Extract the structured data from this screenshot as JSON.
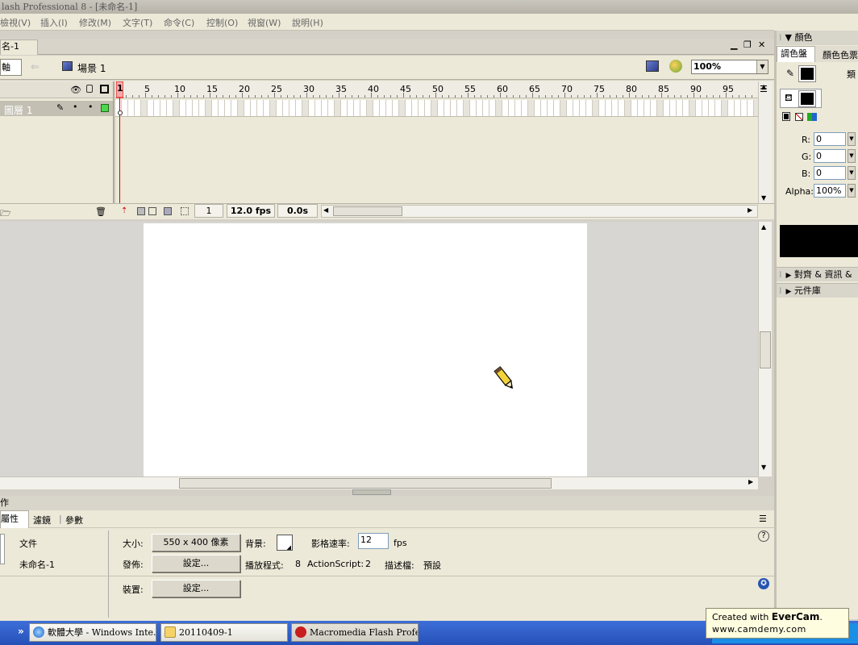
{
  "window": {
    "title": "lash Professional 8 - [未命名-1]"
  },
  "menubar": {
    "items": [
      "檢視(V)",
      "插入(I)",
      "修改(M)",
      "文字(T)",
      "命令(C)",
      "控制(O)",
      "視窗(W)",
      "說明(H)"
    ]
  },
  "document": {
    "tab_label": "名-1",
    "timeline_toggle": "軸",
    "scene_label": "場景 1",
    "zoom": "100%"
  },
  "timeline": {
    "ruler_numbers": [
      "1",
      "5",
      "10",
      "15",
      "20",
      "25",
      "30",
      "35",
      "40",
      "45",
      "50",
      "55",
      "60",
      "65",
      "70",
      "75",
      "80",
      "85",
      "90",
      "95"
    ],
    "layer_name": "圖層 1",
    "current_frame": "1",
    "fps": "12.0 fps",
    "time": "0.0s"
  },
  "properties": {
    "panel_title": "作",
    "tabs": [
      "屬性",
      "濾鏡",
      "參數"
    ],
    "doc_type": "文件",
    "doc_name": "未命名-1",
    "size_label": "大小:",
    "size_value": "550 x 400 像素",
    "bg_label": "背景:",
    "framerate_label": "影格速率:",
    "framerate_value": "12",
    "fps_unit": "fps",
    "publish_label": "發佈:",
    "publish_button": "設定...",
    "player_label": "播放程式:",
    "player_value": "8",
    "as_label": "ActionScript:",
    "as_value": "2",
    "profile_label": "描述檔:",
    "profile_value": "預設",
    "device_label": "裝置:",
    "device_button": "設定..."
  },
  "color_panel": {
    "title": "顏色",
    "tabs": [
      "調色盤",
      "顏色色票"
    ],
    "type_label": "類",
    "r_label": "R:",
    "r_value": "0",
    "g_label": "G:",
    "g_value": "0",
    "b_label": "B:",
    "b_value": "0",
    "alpha_label": "Alpha:",
    "alpha_value": "100%",
    "swatch_color": "#000000",
    "align_panel": "對齊 & 資訊 &",
    "library_panel": "元件庫"
  },
  "taskbar": {
    "items": [
      "軟體大學 - Windows Inte...",
      "20110409-1",
      "Macromedia Flash Profess..."
    ]
  },
  "watermark": {
    "line1_prefix": "Created with ",
    "brand": "EverCam",
    "line2": "www.camdemy.com"
  }
}
